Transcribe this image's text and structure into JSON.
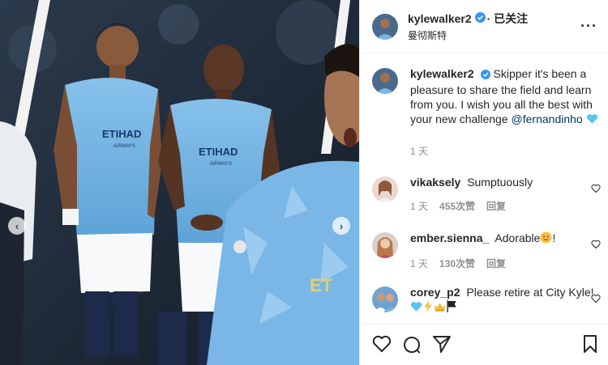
{
  "post": {
    "username": "kylewalker2",
    "follow_status": "· 已关注",
    "location": "曼彻斯特",
    "more_icon": "more-options-icon"
  },
  "caption": {
    "username": "kylewalker2",
    "text": "Skipper it's been a pleasure to share the field and learn from you. I wish you all the best with your new challenge",
    "mention": "@fernandinho",
    "time": "1 天"
  },
  "comments": [
    {
      "username": "vikaksely",
      "text": "Sumptuously",
      "time": "1 天",
      "likes": "455次赞",
      "reply": "回复"
    },
    {
      "username": "ember.sienna_",
      "text": "Adorable",
      "suffix": "!",
      "time": "1 天",
      "likes": "130次赞",
      "reply": "回复"
    },
    {
      "username": "corey_p2",
      "text": "Please retire at City Kyle!"
    }
  ],
  "media": {
    "shirt_text_left": "ETIHAD",
    "shirt_sub_left": "AIRWAYS",
    "shirt_text_mid": "ETIHAD",
    "shirt_sub_mid": "AIRWAYS"
  },
  "colors": {
    "verified": "#3897f0",
    "city_blue": "#77b6e6",
    "link": "#00376b",
    "muted": "#8e8e8e"
  }
}
